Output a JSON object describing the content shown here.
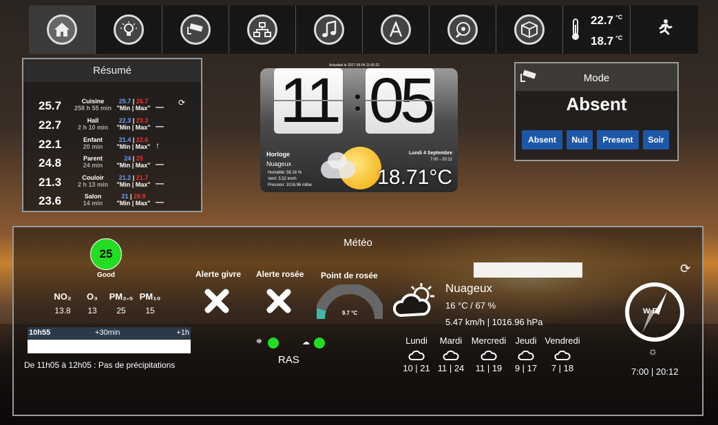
{
  "nav": {
    "items": [
      "home-icon",
      "lightbulb-icon",
      "camera-icon",
      "network-icon",
      "music-icon",
      "letter-a-icon",
      "disc-icon",
      "box-icon"
    ],
    "temp_top": "22.7",
    "temp_bottom": "18.7",
    "temp_unit": "°C"
  },
  "resume": {
    "title": "Résumé",
    "rows": [
      {
        "value": "25.7",
        "name": "Cuisine",
        "duration": "258 h 55 min",
        "min": "25.7",
        "max": "26.7",
        "minmax_label": "\"Min | Max\"",
        "trend": "—"
      },
      {
        "value": "22.7",
        "name": "Hall",
        "duration": "2 h 10 min",
        "min": "22.3",
        "max": "23.3",
        "minmax_label": "\"Min | Max\"",
        "trend": "—"
      },
      {
        "value": "22.1",
        "name": "Enfant",
        "duration": "20 min",
        "min": "21.4",
        "max": "22.6",
        "minmax_label": "\"Min | Max\"",
        "trend": "↑"
      },
      {
        "value": "24.8",
        "name": "Parent",
        "duration": "24 min",
        "min": "24",
        "max": "25",
        "minmax_label": "\"Min | Max\"",
        "trend": "—"
      },
      {
        "value": "21.3",
        "name": "Couloir",
        "duration": "2 h 13 min",
        "min": "21.2",
        "max": "21.7",
        "minmax_label": "\"Min | Max\"",
        "trend": "—"
      },
      {
        "value": "23.6",
        "name": "Salon",
        "duration": "14 min",
        "min": "21",
        "max": "28.9",
        "minmax_label": "\"Min | Max\"",
        "trend": "—"
      }
    ]
  },
  "clock": {
    "updated": "Actualisé le 2017-09-04 11:00:22",
    "hours": "11",
    "minutes": "05",
    "location": "Horloge",
    "condition": "Nuageux",
    "humidity": "Humidité: 58.18 %",
    "wind": "Vent: 5.52 km/h",
    "pressure": "Pression: 1016.96 mBar",
    "date": "Lundi 4 Septembre",
    "sun": "7:00 - 20:12",
    "temperature": "18.71°C"
  },
  "mode": {
    "title": "Mode",
    "current": "Absent",
    "buttons": [
      "Absent",
      "Nuit",
      "Present",
      "Soir"
    ]
  },
  "meteo": {
    "title": "Météo",
    "aqi": "25",
    "aqi_label": "Good",
    "pollutants": [
      {
        "name": "NO₂",
        "value": "13.8"
      },
      {
        "name": "O₃",
        "value": "13"
      },
      {
        "name": "PM₂.₅",
        "value": "25"
      },
      {
        "name": "PM₁₀",
        "value": "15"
      }
    ],
    "rain_scale": {
      "start": "10h55",
      "mid": "+30min",
      "end": "+1h"
    },
    "rain_text": "De 11h05 à 12h05 : Pas de précipitations",
    "alerte_givre": "Alerte givre",
    "alerte_rosee": "Alerte rosée",
    "point_rosee": "Point de rosée",
    "point_rosee_value": "9.7 °C",
    "status": "RAS",
    "condition": "Nuageux",
    "temp_hum": "16 °C / 67 %",
    "wind_pressure": "5.47 km/h | 1016.96 hPa",
    "forecast": [
      {
        "day": "Lundi",
        "temps": "10 | 21"
      },
      {
        "day": "Mardi",
        "temps": "11 | 24"
      },
      {
        "day": "Mercredi",
        "temps": "11 | 19"
      },
      {
        "day": "Jeudi",
        "temps": "9 | 17"
      },
      {
        "day": "Vendredi",
        "temps": "7 | 18"
      }
    ],
    "compass": "WE",
    "sun_times": "7:00 | 20:12"
  },
  "colors": {
    "aqi_good": "#22dd22",
    "mode_button": "#1d57a8",
    "minimum": "#6aa0ff",
    "maximum": "#e33333"
  }
}
